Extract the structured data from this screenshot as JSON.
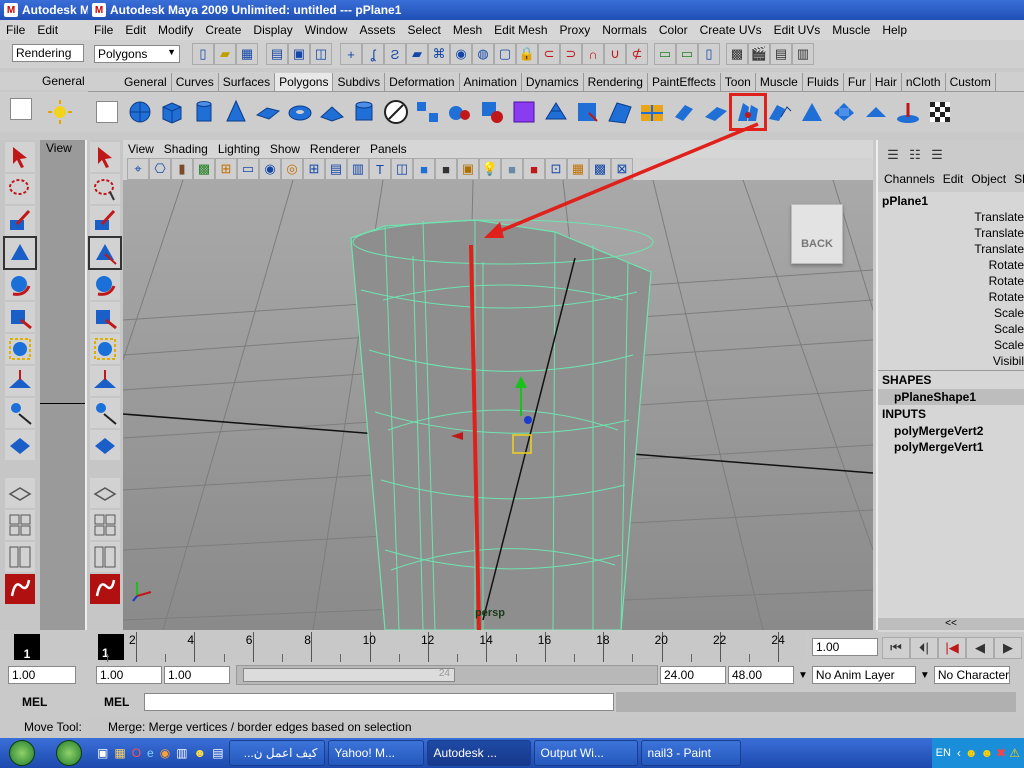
{
  "back_window": {
    "title": "Autodesk M",
    "menu": [
      "File",
      "Edit"
    ],
    "mode": "Rendering",
    "shelf_tab": "General",
    "panel_menu": "View",
    "mel_label": "MEL",
    "status": "Move Tool:",
    "start_field": "1.00",
    "frame_label": "1"
  },
  "main_window": {
    "title": "Autodesk Maya 2009 Unlimited: untitled   ---   pPlane1",
    "menu": [
      "File",
      "Edit",
      "Modify",
      "Create",
      "Display",
      "Window",
      "Assets",
      "Select",
      "Mesh",
      "Edit Mesh",
      "Proxy",
      "Normals",
      "Color",
      "Create UVs",
      "Edit UVs",
      "Muscle",
      "Help"
    ],
    "mode_selector": "Polygons",
    "shelf_tabs": [
      "General",
      "Curves",
      "Surfaces",
      "Polygons",
      "Subdivs",
      "Deformation",
      "Animation",
      "Dynamics",
      "Rendering",
      "PaintEffects",
      "Toon",
      "Muscle",
      "Fluids",
      "Fur",
      "Hair",
      "nCloth",
      "Custom"
    ],
    "active_shelf_tab": "Polygons",
    "panel_menu": [
      "View",
      "Shading",
      "Lighting",
      "Show",
      "Renderer",
      "Panels"
    ],
    "viewport": {
      "camera_label": "persp",
      "view_cube_label": "BACK"
    },
    "channel_box": {
      "menu": [
        "Channels",
        "Edit",
        "Object",
        "Sh"
      ],
      "object_name": "pPlane1",
      "attributes": [
        "Translate",
        "Translate",
        "Translate",
        "Rotate",
        "Rotate",
        "Rotate",
        "Scale",
        "Scale",
        "Scale",
        "Visibil"
      ],
      "shapes_header": "SHAPES",
      "shape": "pPlaneShape1",
      "inputs_header": "INPUTS",
      "inputs": [
        "polyMergeVert2",
        "polyMergeVert1"
      ],
      "scroll_label": "<<"
    },
    "timeline": {
      "current_frame": "1",
      "ticks": [
        "2",
        "4",
        "6",
        "8",
        "10",
        "12",
        "14",
        "16",
        "18",
        "20",
        "22",
        "24"
      ],
      "current_time_field": "1.00"
    },
    "range": {
      "start": "1.00",
      "playback_start": "1.00",
      "range_end_marker": "24",
      "playback_end": "24.00",
      "end": "48.00",
      "anim_layer": "No Anim Layer",
      "character": "No Character"
    },
    "mel_label": "MEL",
    "help_line": "Merge: Merge vertices / border edges based on selection"
  },
  "taskbar": {
    "items": [
      "كيف اعمل ن...",
      "Yahoo! M...",
      "Autodesk ...",
      "Output Wi...",
      "nail3 - Paint"
    ],
    "active_index": 2,
    "language": "EN"
  },
  "colors": {
    "highlight": "#e0201a",
    "wireframe": "#6fe3b0",
    "titlebar": "#2a5cc4"
  }
}
